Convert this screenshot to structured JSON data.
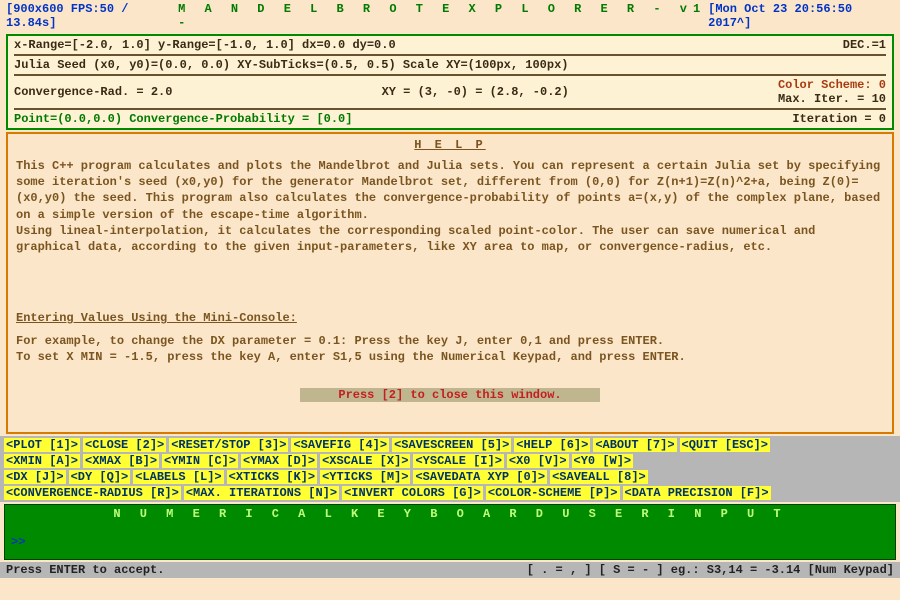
{
  "topbar": {
    "left": "[900x600 FPS:50 / 13.84s]",
    "title": "M A N D E L B R O T   E X P L O R E R  - v1 -",
    "right": "[Mon Oct 23 20:56:50 2017^]"
  },
  "row1": {
    "ranges": "x-Range=[-2.0, 1.0] y-Range=[-1.0, 1.0] dx=0.0 dy=0.0",
    "dec": "DEC.=1"
  },
  "row2": {
    "text": "Julia Seed (x0, y0)=(0.0, 0.0) XY-SubTicks=(0.5, 0.5) Scale XY=(100px, 100px)"
  },
  "row3": {
    "conv": "Convergence-Rad. = 2.0",
    "xy": "XY = (3, -0) = (2.8, -0.2)",
    "scheme": "Color Scheme: 0",
    "iter": "Max. Iter. = 10"
  },
  "row4": {
    "point": "Point=(0.0,0.0)  Convergence-Probability = [0.0]",
    "iteration": "Iteration = 0"
  },
  "help": {
    "title": "H E L P",
    "body1": "This C++ program calculates and plots the Mandelbrot and Julia sets. You can represent a certain Julia set by specifying some iteration's seed (x0,y0) for the generator Mandelbrot set, different from (0,0) for Z(n+1)=Z(n)^2+a, being Z(0)=(x0,y0) the seed. This program also calculates the convergence-probability of points a=(x,y) of the complex plane, based on a simple version of the escape-time algorithm.",
    "body2": "Using lineal-interpolation, it calculates the corresponding scaled point-color. The user can save numerical and graphical data, according to the given input-parameters, like XY area to map, or convergence-radius, etc.",
    "sub": "Entering Values Using the Mini-Console:",
    "ex1": "For example, to change the DX parameter = 0.1: Press the key J, enter 0,1 and press ENTER.",
    "ex2": "To set X MIN = -1.5, press the key A, enter S1,5 using the Numerical Keypad, and press ENTER.",
    "close": "Press [2] to close this window."
  },
  "commands": [
    "<PLOT [1]>",
    "<CLOSE [2]>",
    "<RESET/STOP [3]>",
    "<SAVEFIG [4]>",
    "<SAVESCREEN [5]>",
    "<HELP [6]>",
    "<ABOUT [7]>",
    "<QUIT [ESC]>",
    "<XMIN [A]>",
    "<XMAX [B]>",
    "<YMIN [C]>",
    "<YMAX [D]>",
    "<XSCALE [X]>",
    "<YSCALE [I]>",
    "<X0 [V]>",
    "<Y0 [W]>",
    "<DX [J]>",
    "<DY [Q]>",
    "<LABELS [L]>",
    "<XTICKS [K]>",
    "<YTICKS [M]>",
    "<SAVEDATA XYP [0]>",
    "<SAVEALL [8]>",
    "<CONVERGENCE-RADIUS [R]>",
    "<MAX. ITERATIONS [N]>",
    "<INVERT COLORS [G]>",
    "<COLOR-SCHEME [P]>",
    "<DATA PRECISION [F]>"
  ],
  "numkbd": {
    "title": "N U M E R I C A L   K E Y B O A R D   U S E R   I N P U T",
    "prompt": ">>"
  },
  "status": {
    "left": "Press ENTER to accept.",
    "right": "[ . = , ] [ S = - ] eg.: S3,14 = -3.14 [Num Keypad]"
  }
}
